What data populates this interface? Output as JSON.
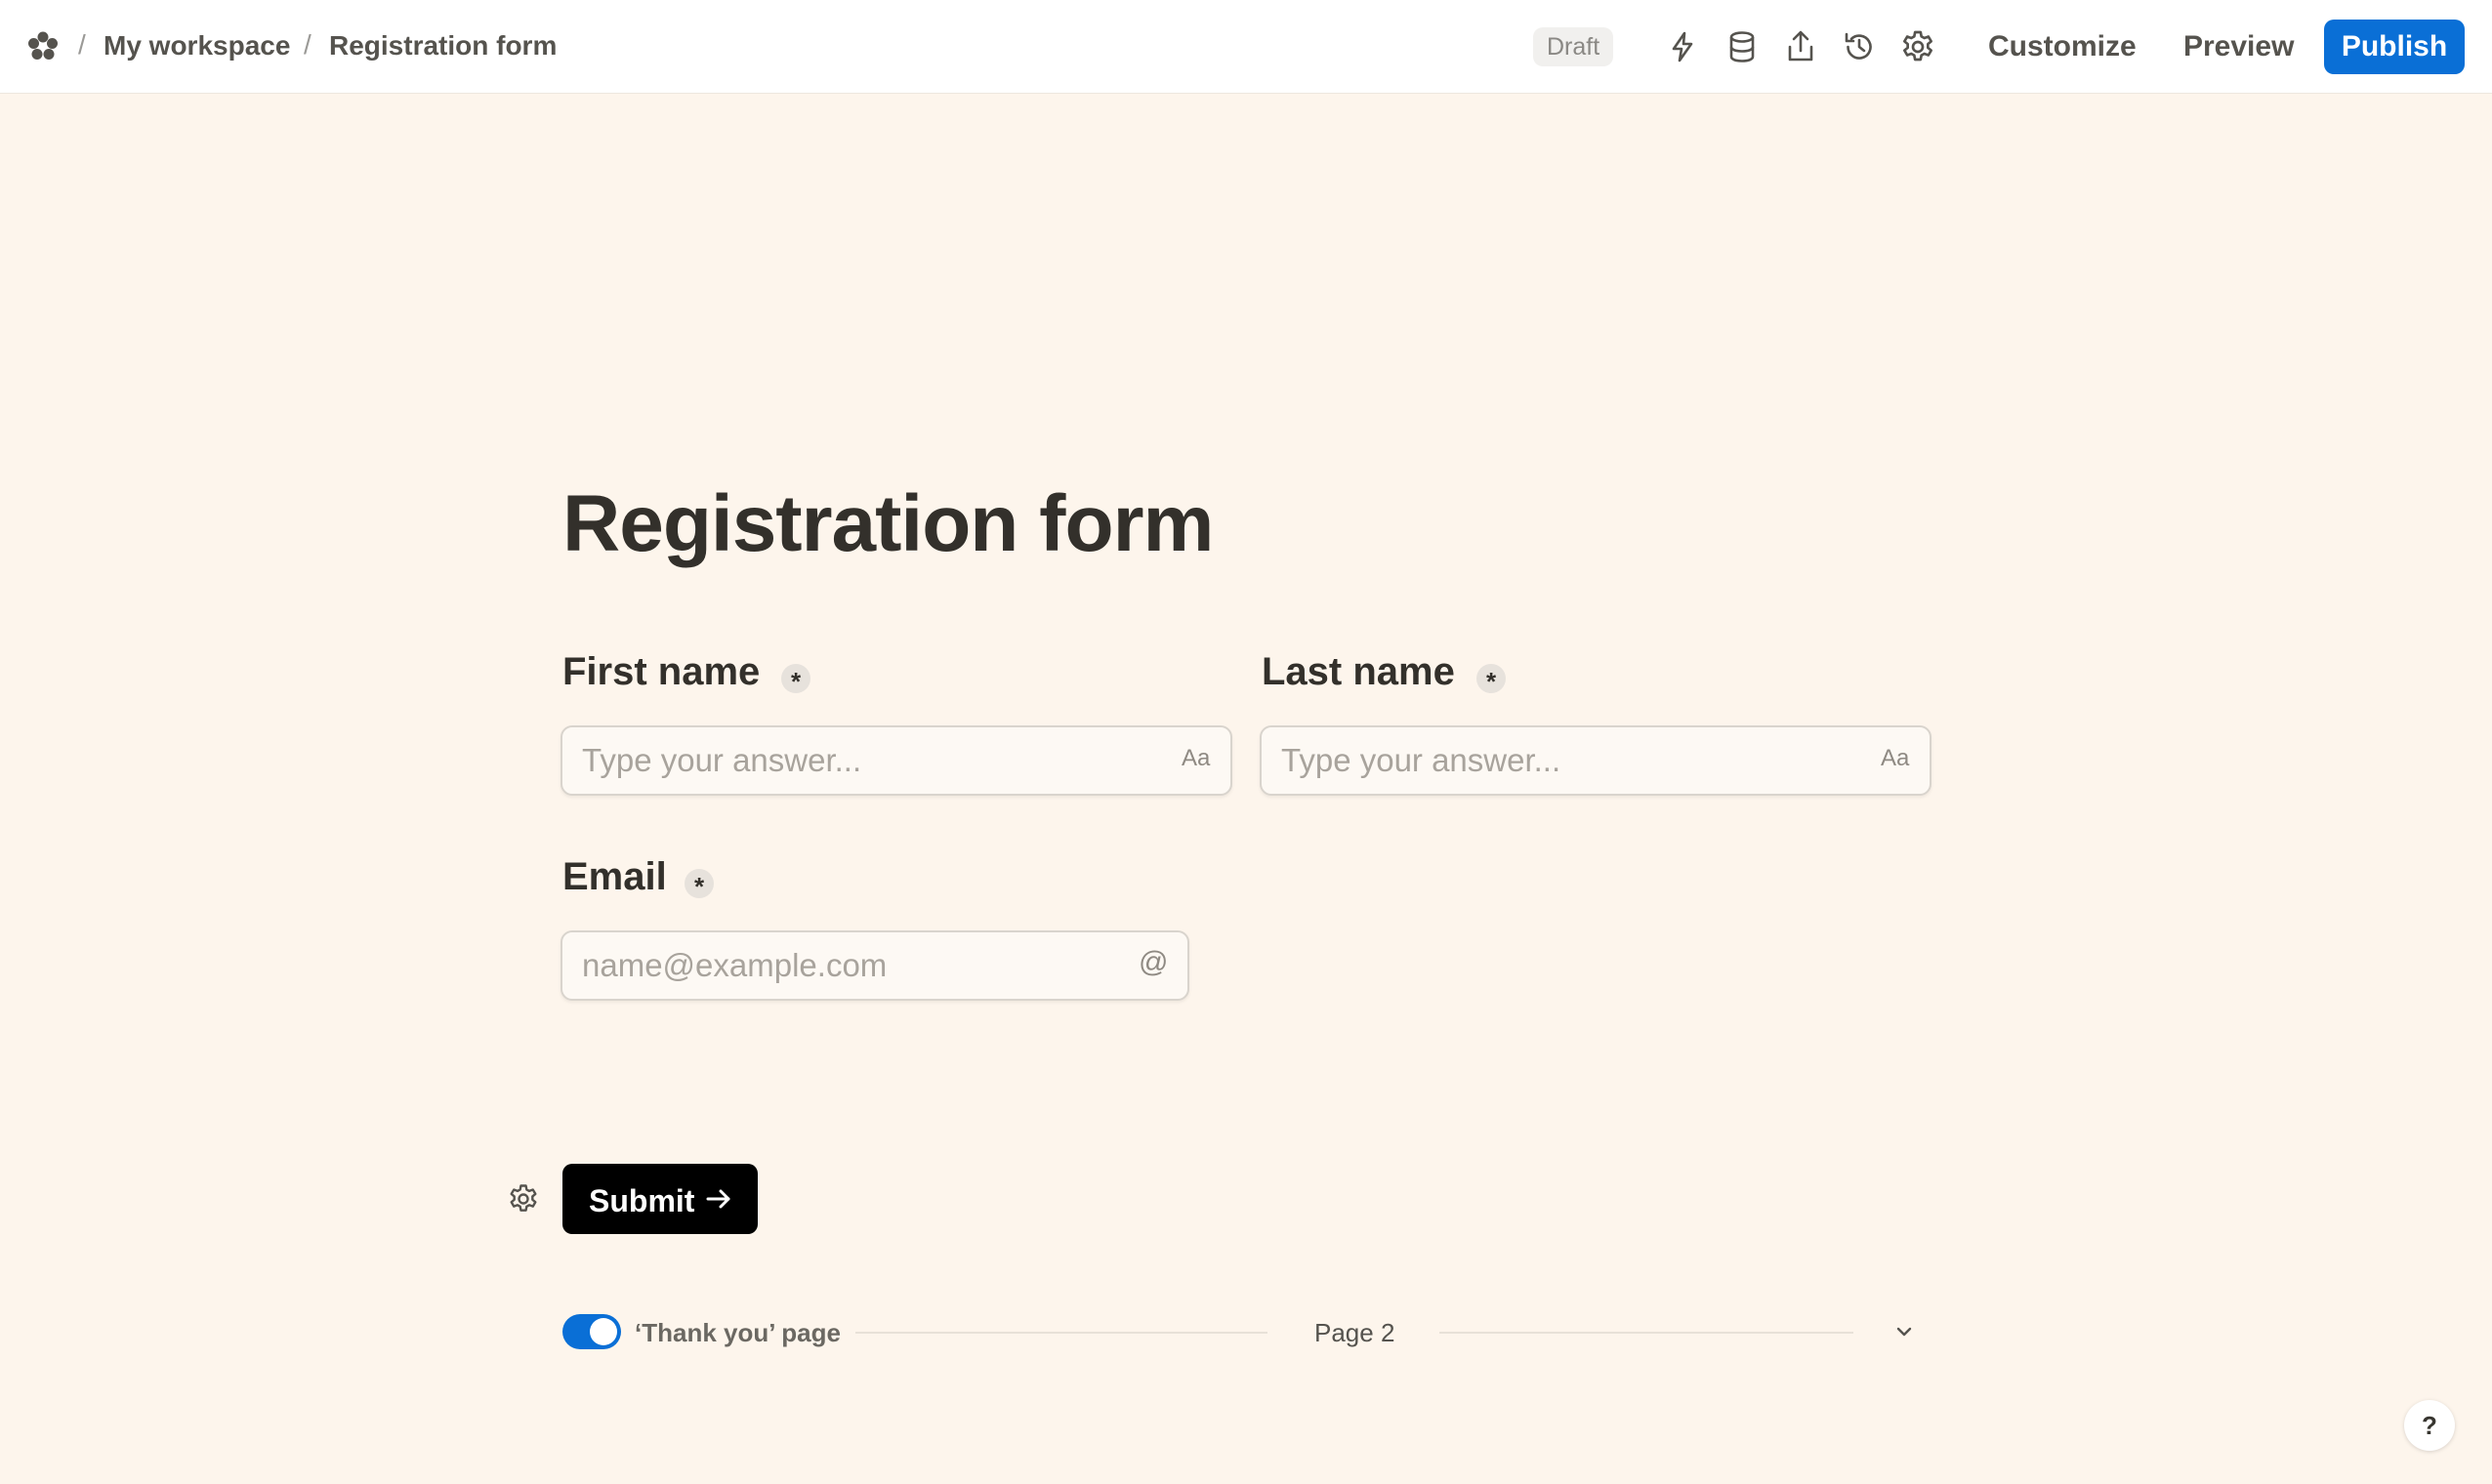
{
  "header": {
    "logo_icon": "flower-logo-icon",
    "breadcrumb": [
      {
        "label": "My workspace"
      },
      {
        "label": "Registration form"
      }
    ],
    "separator": "/",
    "status_badge": "Draft",
    "tools": [
      {
        "icon": "lightning-icon"
      },
      {
        "icon": "database-icon"
      },
      {
        "icon": "share-icon"
      },
      {
        "icon": "history-icon"
      },
      {
        "icon": "gear-icon"
      }
    ],
    "customize_label": "Customize",
    "preview_label": "Preview",
    "publish_label": "Publish",
    "accent_color": "#0a6fd6"
  },
  "form": {
    "title": "Registration form",
    "fields": {
      "first_name": {
        "label": "First name",
        "required_mark": "*",
        "placeholder": "Type your answer...",
        "value": "",
        "type_icon": "Aa"
      },
      "last_name": {
        "label": "Last name",
        "required_mark": "*",
        "placeholder": "Type your answer...",
        "value": "",
        "type_icon": "Aa"
      },
      "email": {
        "label": "Email",
        "required_mark": "*",
        "placeholder": "name@example.com",
        "value": "",
        "type_icon": "@"
      }
    },
    "submit": {
      "label": "Submit",
      "icon": "arrow-right-icon",
      "settings_icon": "gear-icon"
    }
  },
  "thank_you": {
    "enabled": true,
    "label": "‘Thank you’ page",
    "page_label": "Page 2",
    "chevron_icon": "chevron-down-icon"
  },
  "help": {
    "label": "?"
  },
  "colors": {
    "page_background": "#fdf5ec",
    "toggle_on": "#0a6fd6",
    "submit_background": "#000000"
  }
}
